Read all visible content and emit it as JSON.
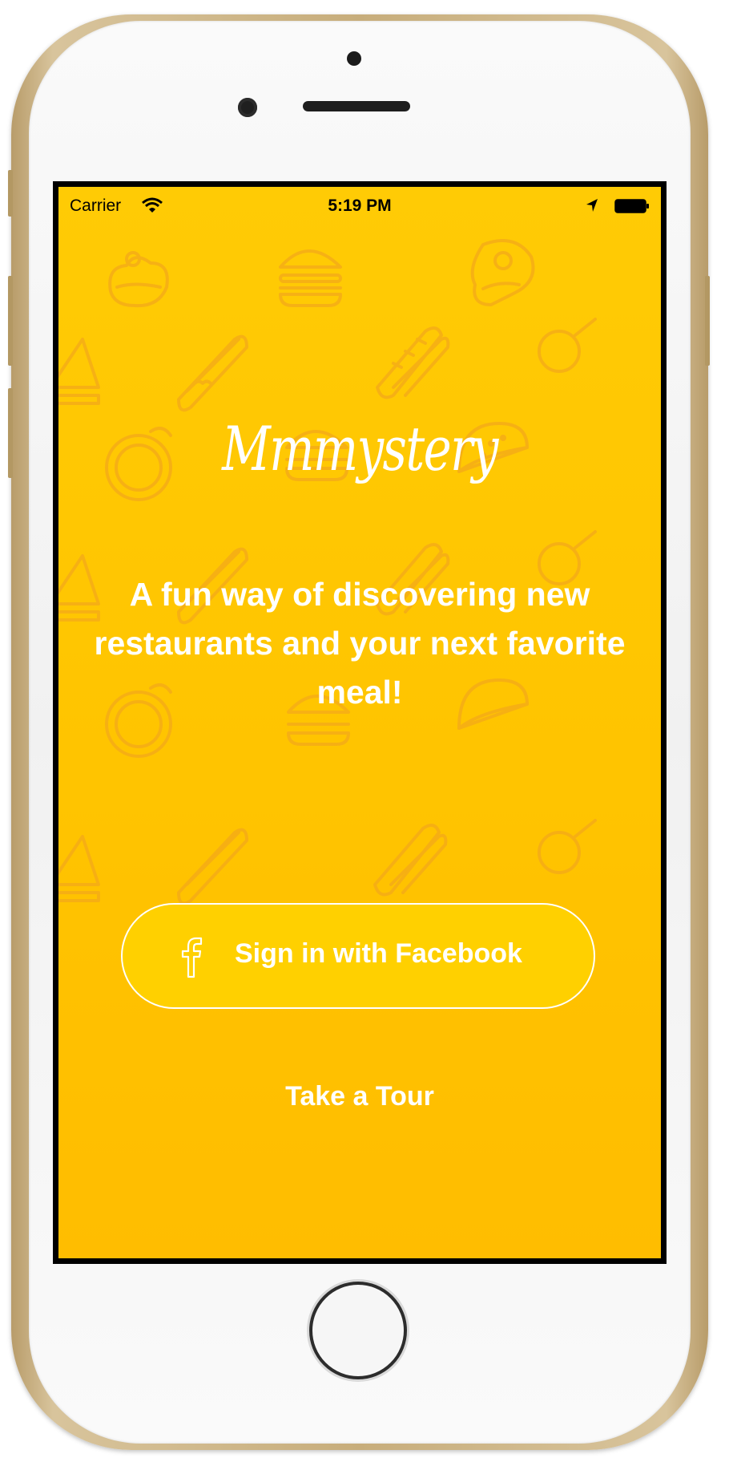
{
  "status_bar": {
    "carrier": "Carrier",
    "time": "5:19 PM",
    "icons": [
      "wifi-icon",
      "location-arrow-icon",
      "battery-icon"
    ]
  },
  "app": {
    "logo": "Mmmystery",
    "tagline": "A fun way of discovering new restaurants and your next favorite meal!",
    "facebook_button": {
      "label": "Sign in with Facebook",
      "icon": "facebook-icon"
    },
    "tour_link": "Take a Tour"
  },
  "background_icons": [
    "cake-icon",
    "burger-icon",
    "steak-icon",
    "hotdog-icon",
    "baguette-icon",
    "sandwich-icon",
    "taco-icon",
    "coffee-cup-icon",
    "chicken-leg-icon"
  ],
  "colors": {
    "background": "#ffc400",
    "pattern": "#f4a91a",
    "text": "#ffffff",
    "phone_frame": "#c7ad7b"
  }
}
